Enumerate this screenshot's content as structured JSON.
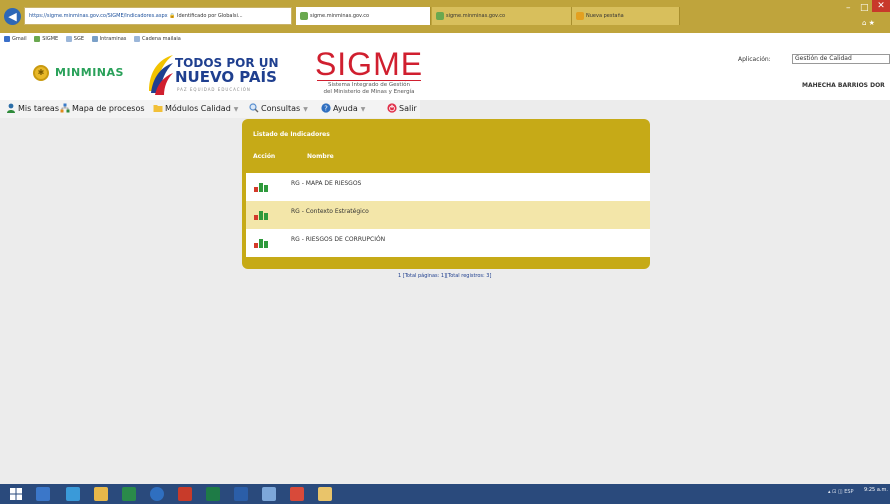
{
  "browser": {
    "url": "https://sigme.minminas.gov.co/SIGME/Indicadores.aspx",
    "lock_text": "Identificado por Globalsi...",
    "tabs": [
      {
        "label": "sigme.minminas.gov.co",
        "active": true
      },
      {
        "label": "sigme.minminas.gov.co",
        "active": false
      },
      {
        "label": "Nueva pestaña",
        "active": false
      }
    ],
    "window_controls": {
      "minimize": "–",
      "maximize": "□",
      "close": "✕"
    },
    "favorites": [
      "Gmail",
      "SIGME",
      "SGE",
      "Intraminas",
      "Cadena mailaia"
    ]
  },
  "header": {
    "minminas_logo": "MINMINAS",
    "tpnp_line1": "TODOS POR UN",
    "tpnp_line2": "NUEVO PAÍS",
    "tpnp_line3": "PAZ EQUIDAD EDUCACIÓN",
    "sigme_title": "SIGME",
    "sigme_sub1": "Sistema Integrado de Gestión",
    "sigme_sub2": "del Ministerio de Minas y Energía",
    "app_label": "Aplicación:",
    "app_value": "Gestión de Calidad",
    "user_name": "MAHECHA BARRIOS DOR"
  },
  "menu": {
    "mis_tareas": "Mis tareas",
    "mapa_procesos": "Mapa de procesos",
    "modulos_calidad": "Módulos Calidad",
    "consultas": "Consultas",
    "ayuda": "Ayuda",
    "salir": "Salir"
  },
  "panel": {
    "title": "Listado de Indicadores",
    "col_accion": "Acción",
    "col_nombre": "Nombre",
    "rows": [
      {
        "nombre": "RG - MAPA DE RIESGOS"
      },
      {
        "nombre": "RG - Contexto Estratégico"
      },
      {
        "nombre": "RG - RIESGOS DE CORRUPCIÓN"
      }
    ]
  },
  "pager": "1 [Total páginas: 1][Total registros: 3]",
  "taskbar": {
    "tray": "▴ ⊡ ◫ ESP",
    "clock": "9:25 a.m."
  },
  "colors": {
    "panel": "#c6aa17",
    "panel_row_alt": "#f3e6a9",
    "sigme_red": "#d01f2f",
    "minminas_green": "#2aa15a",
    "browser_chrome": "#bfa43c",
    "taskbar": "#2a4a7c"
  }
}
